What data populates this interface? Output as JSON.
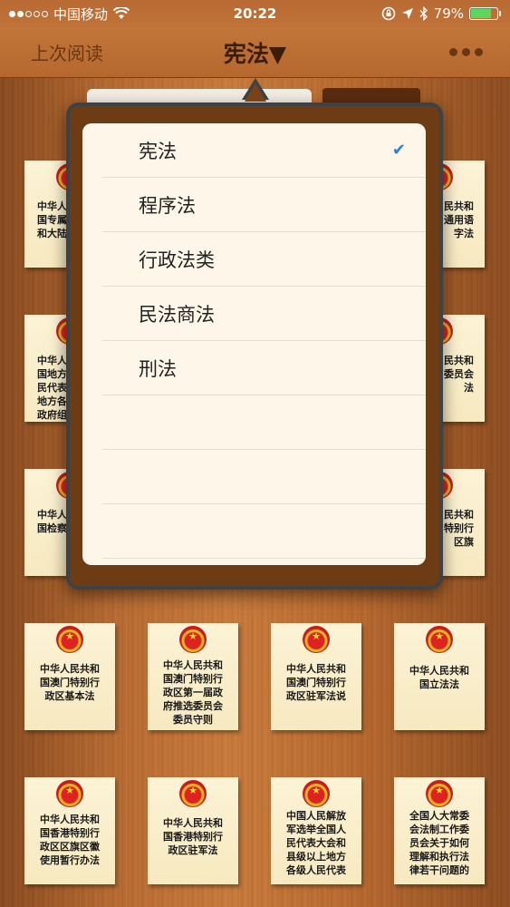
{
  "status": {
    "carrier": "中国移动",
    "time": "20:22",
    "battery": "79%",
    "battery_level": 0.79
  },
  "nav": {
    "left": "上次阅读",
    "title": "宪法▼"
  },
  "popover": {
    "items": [
      {
        "label": "宪法",
        "checked": true
      },
      {
        "label": "程序法"
      },
      {
        "label": "行政法类"
      },
      {
        "label": "民法商法"
      },
      {
        "label": "刑法"
      },
      {
        "label": ""
      },
      {
        "label": ""
      },
      {
        "label": ""
      }
    ]
  },
  "cards": {
    "row1": [
      "中华人\n国专属\n和大陆",
      "",
      "",
      "民共和\n通用语\n字法"
    ],
    "row2": [
      "中华人\n国地方\n民代表\n地方各\n政府组",
      "",
      "",
      "民共和\n委员会\n法"
    ],
    "row3": [
      "中华人\n国检察",
      "",
      "",
      "民共和\n特别行\n区旗"
    ],
    "row4": [
      "中华人民共和\n国澳门特别行\n政区基本法",
      "中华人民共和\n国澳门特别行\n政区第一届政\n府推选委员会\n委员守则",
      "中华人民共和\n国澳门特别行\n政区驻军法说",
      "中华人民共和\n国立法法"
    ],
    "row5": [
      "中华人民共和\n国香港特别行\n政区区旗区徽\n使用暂行办法",
      "中华人民共和\n国香港特别行\n政区驻军法",
      "中国人民解放\n军选举全国人\n民代表大会和\n县级以上地方\n各级人民代表",
      "全国人大常委\n会法制工作委\n员会关于如何\n理解和执行法\n律若干问题的"
    ]
  }
}
